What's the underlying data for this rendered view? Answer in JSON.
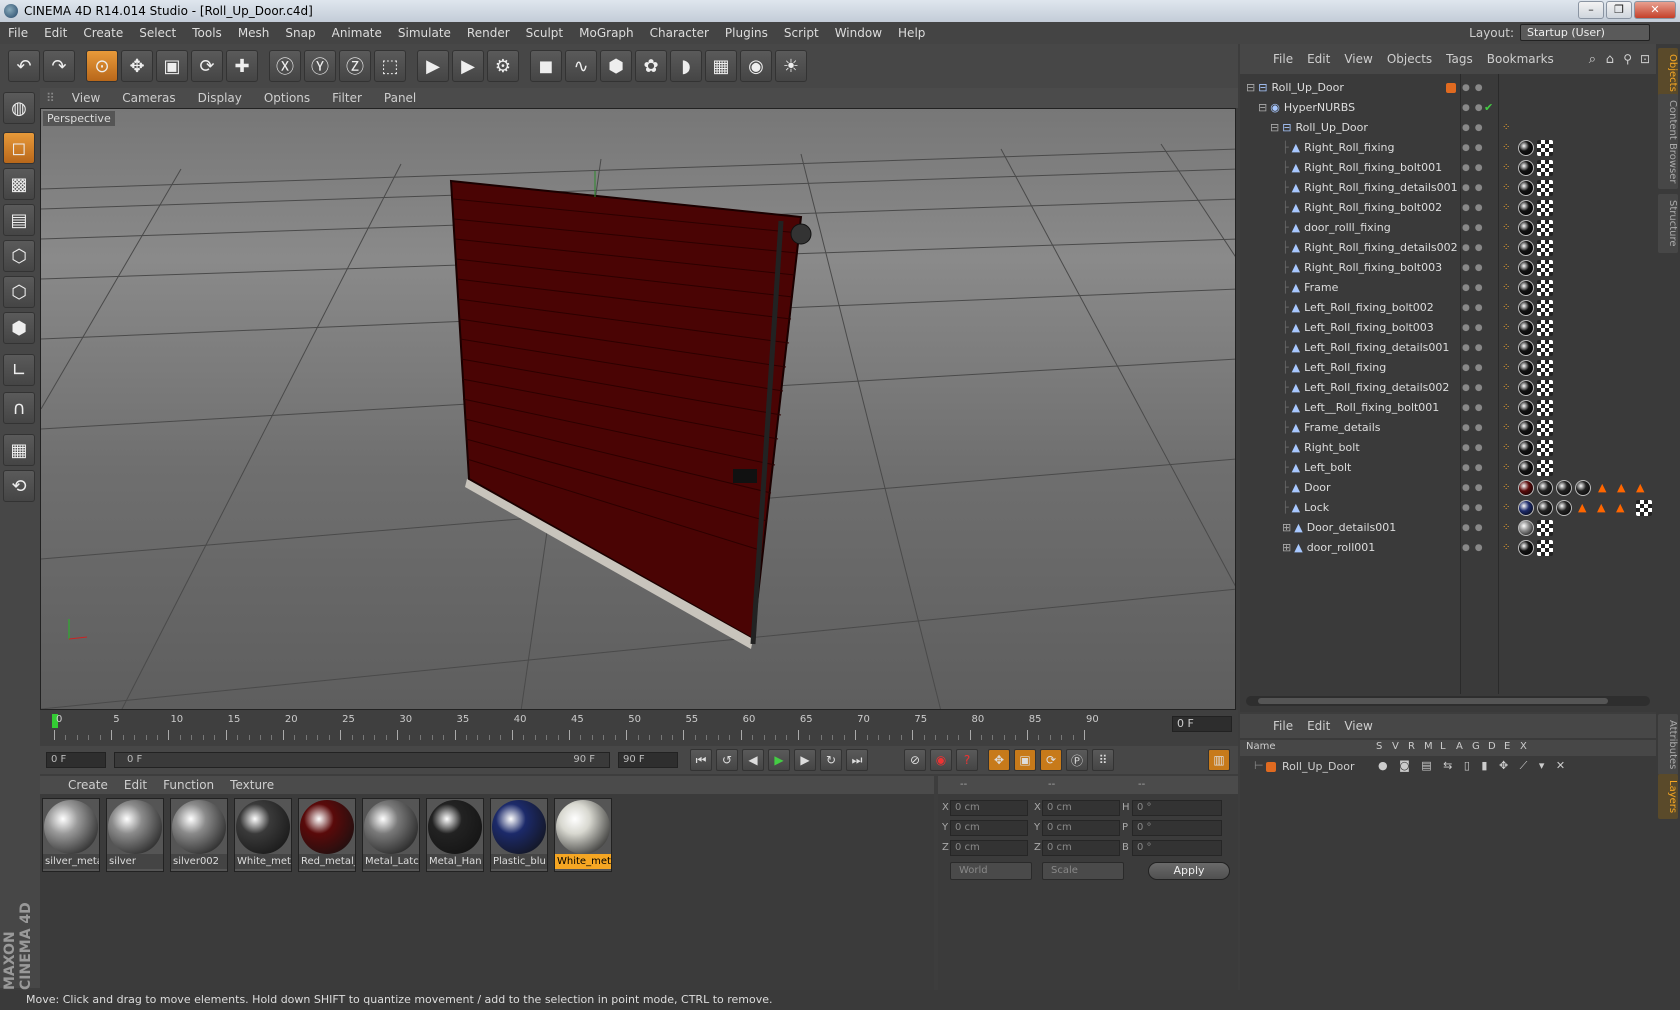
{
  "window": {
    "title": "CINEMA 4D R14.014 Studio - [Roll_Up_Door.c4d]",
    "min": "–",
    "max": "❐",
    "close": "✕"
  },
  "menu": [
    "File",
    "Edit",
    "Create",
    "Select",
    "Tools",
    "Mesh",
    "Snap",
    "Animate",
    "Simulate",
    "Render",
    "Sculpt",
    "MoGraph",
    "Character",
    "Plugins",
    "Script",
    "Window",
    "Help"
  ],
  "layout": {
    "label": "Layout:",
    "value": "Startup (User)"
  },
  "viewport": {
    "menu": [
      "View",
      "Cameras",
      "Display",
      "Options",
      "Filter",
      "Panel"
    ],
    "label": "Perspective"
  },
  "timeline": {
    "ticks": [
      "0",
      "5",
      "10",
      "15",
      "20",
      "25",
      "30",
      "35",
      "40",
      "45",
      "50",
      "55",
      "60",
      "65",
      "70",
      "75",
      "80",
      "85",
      "90"
    ],
    "frame": "0 F"
  },
  "playbar": {
    "start": "0 F",
    "range_start": "0 F",
    "range_end": "90 F",
    "end": "90 F"
  },
  "materials": {
    "menu": [
      "Create",
      "Edit",
      "Function",
      "Texture"
    ],
    "items": [
      {
        "name": "silver_meta",
        "color": "#9a9a9a"
      },
      {
        "name": "silver",
        "color": "#8c8c8c"
      },
      {
        "name": "silver002",
        "color": "#8a8a8a"
      },
      {
        "name": "White_met",
        "color": "#3a3a3a"
      },
      {
        "name": "Red_metal_",
        "color": "#5a0a0a"
      },
      {
        "name": "Metal_Latcl",
        "color": "#7a7a7a"
      },
      {
        "name": "Metal_Han",
        "color": "#222222"
      },
      {
        "name": "Plastic_blu",
        "color": "#1c2a6a"
      },
      {
        "name": "White_met",
        "color": "#d8d8d0",
        "selected": true
      }
    ]
  },
  "coords": {
    "dash1": "--",
    "dash2": "--",
    "dash3": "--",
    "rows": [
      {
        "a": "X",
        "av": "0 cm",
        "b": "X",
        "bv": "0 cm",
        "c": "H",
        "cv": "0 °"
      },
      {
        "a": "Y",
        "av": "0 cm",
        "b": "Y",
        "bv": "0 cm",
        "c": "P",
        "cv": "0 °"
      },
      {
        "a": "Z",
        "av": "0 cm",
        "b": "Z",
        "bv": "0 cm",
        "c": "B",
        "cv": "0 °"
      }
    ],
    "world": "World",
    "scale": "Scale",
    "apply": "Apply"
  },
  "objects": {
    "menu": [
      "File",
      "Edit",
      "View",
      "Objects",
      "Tags",
      "Bookmarks"
    ],
    "items": [
      {
        "name": "Roll_Up_Door",
        "depth": 0,
        "expander": "⊟"
      },
      {
        "name": "HyperNURBS",
        "depth": 1,
        "expander": "⊟"
      },
      {
        "name": "Roll_Up_Door",
        "depth": 2,
        "expander": "⊟"
      },
      {
        "name": "Right_Roll_fixing",
        "depth": 3
      },
      {
        "name": "Right_Roll_fixing_bolt001",
        "depth": 3
      },
      {
        "name": "Right_Roll_fixing_details001",
        "depth": 3
      },
      {
        "name": "Right_Roll_fixing_bolt002",
        "depth": 3
      },
      {
        "name": "door_rolll_fixing",
        "depth": 3
      },
      {
        "name": "Right_Roll_fixing_details002",
        "depth": 3
      },
      {
        "name": "Right_Roll_fixing_bolt003",
        "depth": 3
      },
      {
        "name": "Frame",
        "depth": 3
      },
      {
        "name": "Left_Roll_fixing_bolt002",
        "depth": 3
      },
      {
        "name": "Left_Roll_fixing_bolt003",
        "depth": 3
      },
      {
        "name": "Left_Roll_fixing_details001",
        "depth": 3
      },
      {
        "name": "Left_Roll_fixing",
        "depth": 3
      },
      {
        "name": "Left_Roll_fixing_details002",
        "depth": 3
      },
      {
        "name": "Left__Roll_fixing_bolt001",
        "depth": 3
      },
      {
        "name": "Frame_details",
        "depth": 3
      },
      {
        "name": "Right_bolt",
        "depth": 3
      },
      {
        "name": "Left_bolt",
        "depth": 3
      },
      {
        "name": "Door",
        "depth": 3
      },
      {
        "name": "Lock",
        "depth": 3
      },
      {
        "name": "Door_details001",
        "depth": 3,
        "expander": "⊞"
      },
      {
        "name": "door_roll001",
        "depth": 3,
        "expander": "⊞"
      }
    ]
  },
  "layers": {
    "menu": [
      "File",
      "Edit",
      "View"
    ],
    "head": [
      "Name",
      "S",
      "V",
      "R",
      "M",
      "L",
      "A",
      "G",
      "D",
      "E",
      "X"
    ],
    "row": "Roll_Up_Door"
  },
  "sidetabs": [
    "Objects",
    "Content Browser",
    "Structure"
  ],
  "sidetabs2": [
    "Attributes",
    "Layers"
  ],
  "maxon": "MAXON CINEMA 4D",
  "status": "Move: Click and drag to move elements. Hold down SHIFT to quantize movement / add to the selection in point mode, CTRL to remove."
}
